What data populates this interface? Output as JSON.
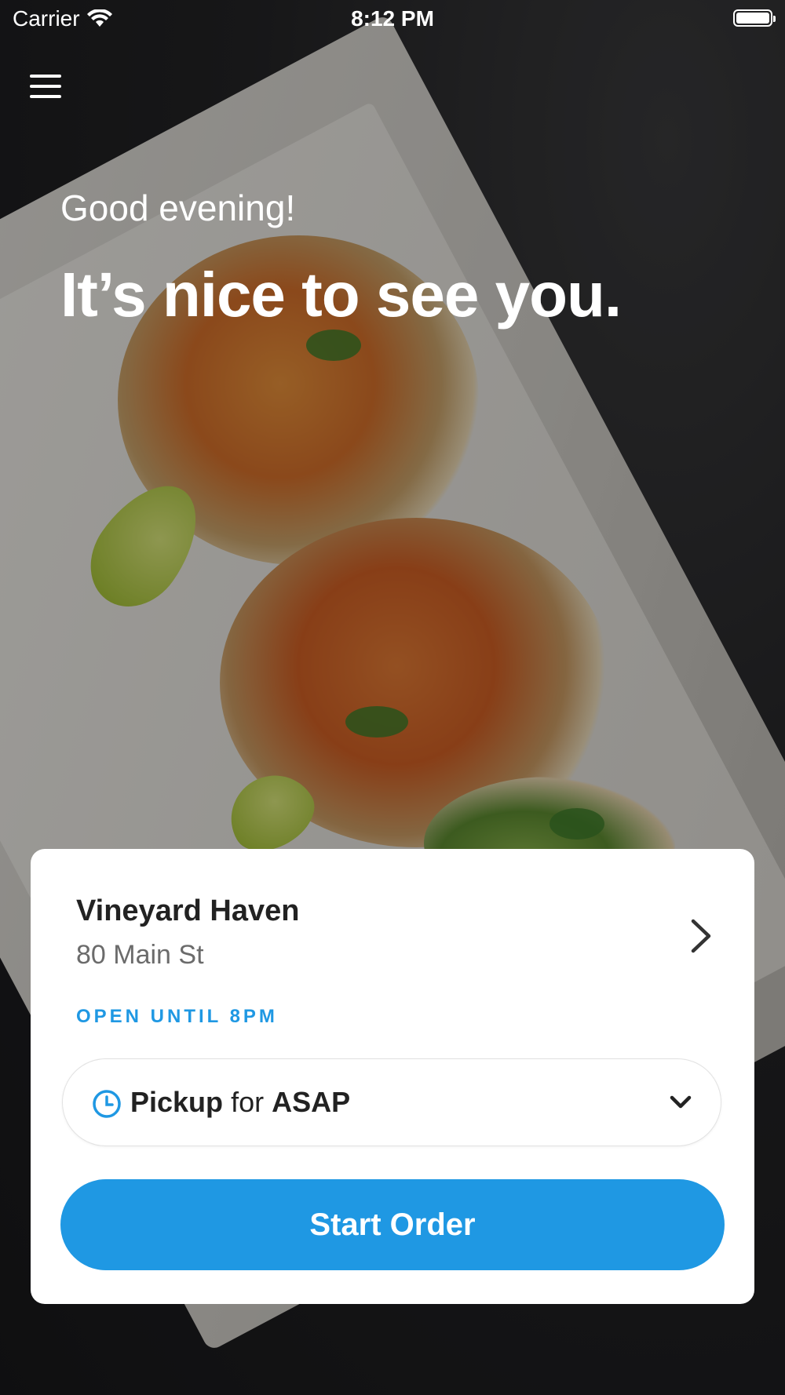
{
  "status_bar": {
    "carrier": "Carrier",
    "time": "8:12 PM",
    "battery_level": 1.0
  },
  "header": {
    "menu_icon": "hamburger-menu-icon"
  },
  "hero": {
    "greeting": "Good evening!",
    "headline": "It’s nice to see you."
  },
  "location_card": {
    "name": "Vineyard Haven",
    "address": "80 Main St",
    "status": "OPEN UNTIL 8PM",
    "mode": {
      "icon": "clock-icon",
      "type": "Pickup",
      "connector": "for",
      "time": "ASAP"
    },
    "start_button": "Start Order"
  },
  "colors": {
    "accent": "#1F98E3",
    "card_background": "#FFFFFF",
    "text_primary": "#222222",
    "text_secondary": "#6B6B6B"
  }
}
